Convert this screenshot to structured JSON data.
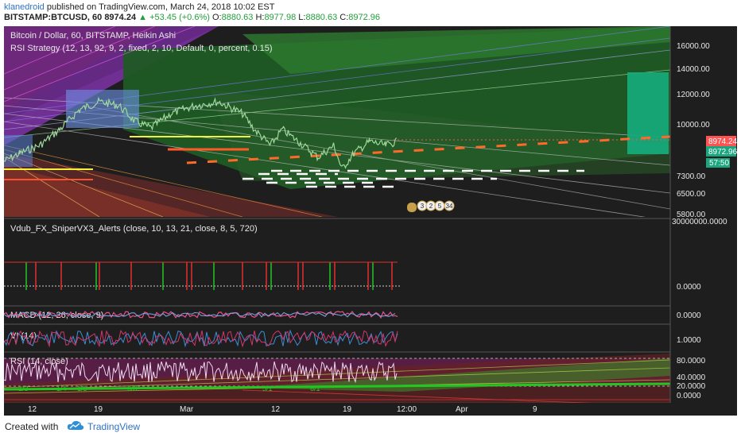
{
  "header": {
    "user": "klanedroid",
    "published_text": "published on TradingView.com, March 24, 2018 10:02 EST",
    "symbol": "BITSTAMP:BTCUSD, 60",
    "price": "8974.24",
    "change": "▲ +53.45 (+0.6%)",
    "o_label": "O:",
    "o_value": "8880.63",
    "h_label": "H:",
    "h_value": "8977.98",
    "l_label": "L:",
    "l_value": "8880.63",
    "c_label": "C:",
    "c_value": "8972.96"
  },
  "main_pane": {
    "title": "Bitcoin / Dollar, 60, BITSTAMP, Heikin Ashi",
    "strategy": "RSI Strategy (12, 13, 92, 9, 2, fixed, 2, 10, Default, 0, percent, 0.15)",
    "price_ticks": [
      "16000.00",
      "14000.00",
      "12000.00",
      "10000.00",
      "7300.00",
      "6500.00",
      "5800.00"
    ],
    "tag_last": "8974.24",
    "tag_close": "8972.96",
    "tag_timer": "57:50",
    "event_badges": [
      "3",
      "2",
      "5",
      "34"
    ]
  },
  "sniper_pane": {
    "title": "Vdub_FX_SniperVX3_Alerts (close, 10, 13, 21, close, 8, 5, 720)",
    "ticks": [
      "30000000.0000",
      "0.0000"
    ]
  },
  "macd_pane": {
    "title": "MACD (12, 26, close, 9)",
    "tick": "0.0000"
  },
  "vi_pane": {
    "title": "VI (14)",
    "tick": "1.0000"
  },
  "rsi_pane": {
    "title": "RSI (14, close)",
    "ticks": [
      "80.0000",
      "40.0000",
      "20.0000",
      "0.0000"
    ],
    "labels": [
      "1/3",
      "1/4",
      "1/5",
      "6/8",
      "5/1",
      "6/1"
    ]
  },
  "time_axis": [
    "12",
    "19",
    "Mar",
    "12",
    "19",
    "12:00",
    "Apr",
    "9"
  ],
  "footer": {
    "created_with": "Created with",
    "brand": "TradingView"
  },
  "colors": {
    "background": "#1e1e1e",
    "up": "#26a69a",
    "signal_red": "#ff5252",
    "brand": "#2f72c4"
  }
}
